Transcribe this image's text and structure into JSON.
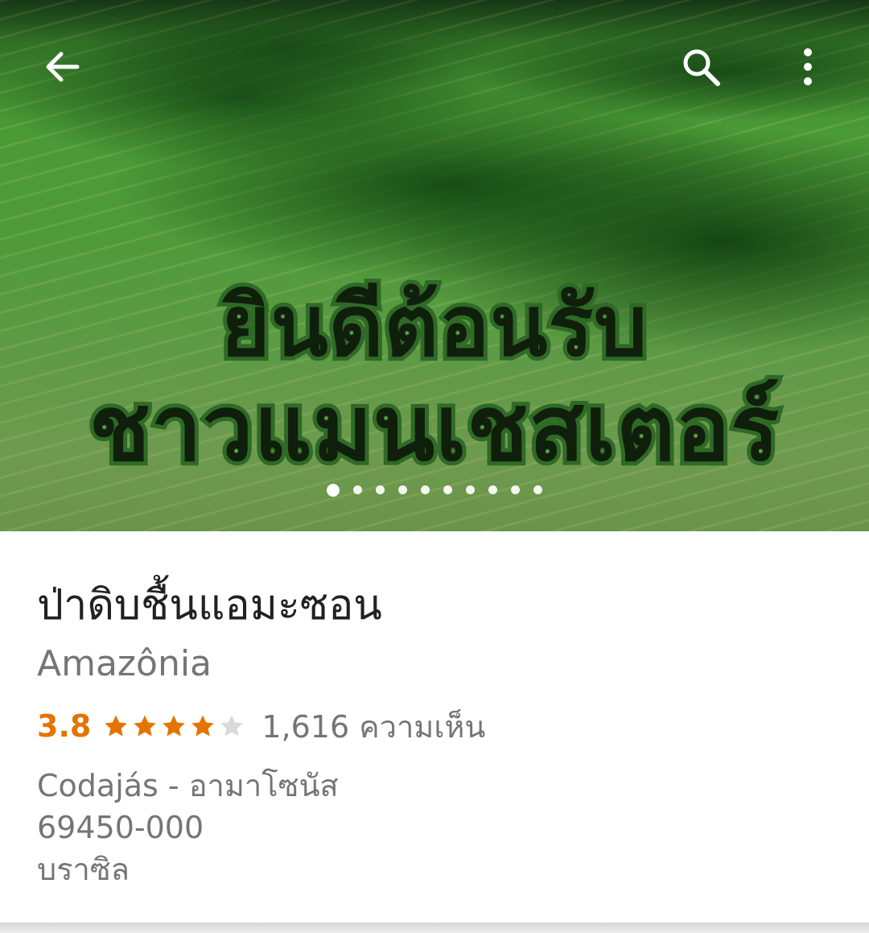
{
  "hero": {
    "line1": "ยินดีต้อนรับ",
    "line2": "ชาวแมนเชสเตอร์",
    "carousel_count": 10,
    "carousel_active": 0
  },
  "toolbar": {
    "back_icon": "arrow-left-icon",
    "search_icon": "search-icon",
    "more_icon": "more-vert-icon"
  },
  "place": {
    "name": "ป่าดิบชื้นแอมะซอน",
    "subtitle": "Amazônia",
    "rating": "3.8",
    "rating_value": 3.8,
    "stars_filled": 4,
    "stars_total": 5,
    "reviews": "1,616 ความเห็น",
    "address_line1": "Codajás - อามาโซนัส",
    "address_line2": "69450-000",
    "address_line3": "บราซิล"
  },
  "colors": {
    "rating": "#e37400",
    "star_filled": "#e37400",
    "star_empty": "#dadada",
    "text_primary": "#212121",
    "text_secondary": "#757575"
  }
}
